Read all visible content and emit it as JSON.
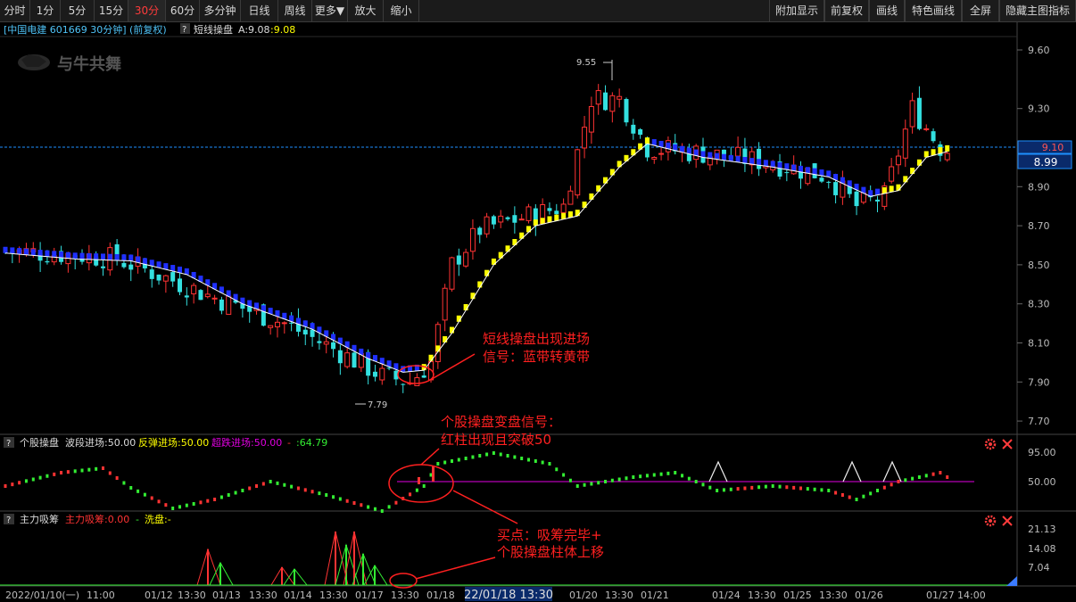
{
  "toolbar": {
    "left": [
      "分时",
      "1分",
      "5分",
      "15分",
      "30分",
      "60分",
      "多分钟",
      "日线",
      "周线",
      "更多▼",
      "放大",
      "缩小"
    ],
    "active": "30分",
    "right": [
      "附加显示",
      "前复权",
      "画线",
      "特色画线",
      "全屏",
      "隐藏主图指标"
    ]
  },
  "main": {
    "header": "[中国电建 601669 30分钟] (前复权)",
    "help": "?",
    "indicator": "短线操盘",
    "ind_a": "A:9.08",
    "ind_b": ":9.08",
    "watermark": "与牛共舞",
    "y_ticks": [
      "9.60",
      "9.30",
      "9.10",
      "8.90",
      "8.70",
      "8.50",
      "8.30",
      "8.10",
      "7.90",
      "7.70"
    ],
    "price_tag_current": "9.10",
    "price_tag_cursor": "8.99",
    "high_label": "9.55",
    "low_label": "7.79",
    "annot1_line1": "短线操盘出现进场",
    "annot1_line2": "信号：蓝带转黄带"
  },
  "panel2": {
    "help": "?",
    "name": "个股操盘",
    "s1": "波段进场:50.00",
    "s2": "反弹进场:50.00",
    "s3": "超跌进场:50.00",
    "s4": "-",
    "s5": ":64.79",
    "y_ticks": [
      "95.00",
      "50.00"
    ],
    "annot_line1": "个股操盘变盘信号：",
    "annot_line2": "红柱出现且突破50"
  },
  "panel3": {
    "help": "?",
    "name": "主力吸筹",
    "s1": "主力吸筹:0.00",
    "s2": "洗盘:-",
    "s3": "-",
    "y_ticks": [
      "21.13",
      "14.08",
      "7.04"
    ],
    "annot_line1": "买点：吸筹完毕+",
    "annot_line2": "个股操盘柱体上移"
  },
  "xaxis": {
    "labels": [
      "2022/01/10(一)",
      "11:00",
      "01/12",
      "13:30",
      "01/13",
      "13:30",
      "01/14",
      "13:30",
      "01/17",
      "13:30",
      "01/18",
      "01/20",
      "13:30",
      "01/21",
      "01/24",
      "13:30",
      "01/25",
      "13:30",
      "01/26",
      "01/27",
      "14:00"
    ],
    "cursor": "22/01/18 13:30"
  },
  "colors": {
    "up": "#ff3333",
    "down": "#33e0e0",
    "yellow": "#ffff00",
    "blue": "#2030ff",
    "magenta": "#e000e0",
    "green": "#33ee33"
  },
  "icons": [
    "gear-icon",
    "close-icon",
    "help-icon"
  ]
}
